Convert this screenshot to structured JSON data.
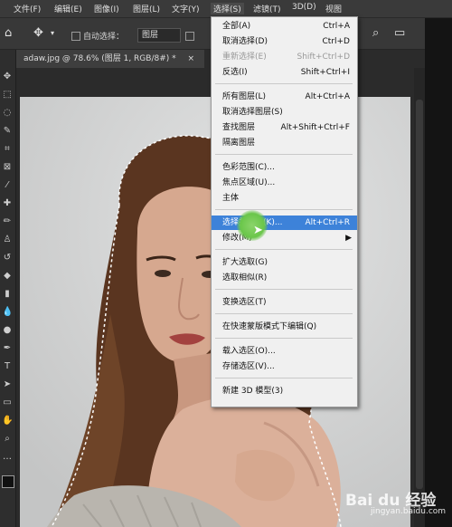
{
  "menubar": {
    "items": [
      {
        "label": "文件(F)"
      },
      {
        "label": "编辑(E)"
      },
      {
        "label": "图像(I)"
      },
      {
        "label": "图层(L)"
      },
      {
        "label": "文字(Y)"
      },
      {
        "label": "选择(S)"
      },
      {
        "label": "滤镜(T)"
      },
      {
        "label": "3D(D)"
      },
      {
        "label": "视图"
      }
    ]
  },
  "options_bar": {
    "auto_select_label": "自动选择：",
    "auto_select_target": "图层"
  },
  "document_tab": {
    "title": "adaw.jpg @ 78.6% (图层 1, RGB/8#) *",
    "close": "×"
  },
  "select_menu": {
    "items": [
      {
        "label": "全部(A)",
        "shortcut": "Ctrl+A"
      },
      {
        "label": "取消选择(D)",
        "shortcut": "Ctrl+D"
      },
      {
        "label": "重新选择(E)",
        "shortcut": "Shift+Ctrl+D",
        "disabled": true
      },
      {
        "label": "反选(I)",
        "shortcut": "Shift+Ctrl+I"
      },
      {
        "label": "所有图层(L)",
        "shortcut": "Alt+Ctrl+A"
      },
      {
        "label": "取消选择图层(S)",
        "shortcut": ""
      },
      {
        "label": "查找图层",
        "shortcut": "Alt+Shift+Ctrl+F"
      },
      {
        "label": "隔离图层",
        "shortcut": ""
      },
      {
        "label": "色彩范围(C)...",
        "shortcut": ""
      },
      {
        "label": "焦点区域(U)...",
        "shortcut": ""
      },
      {
        "label": "主体",
        "shortcut": ""
      },
      {
        "label": "选择并遮住(K)...",
        "shortcut": "Alt+Ctrl+R",
        "highlighted": true
      },
      {
        "label": "修改(M)",
        "shortcut": "",
        "submenu": "▶"
      },
      {
        "label": "扩大选取(G)",
        "shortcut": ""
      },
      {
        "label": "选取相似(R)",
        "shortcut": ""
      },
      {
        "label": "变换选区(T)",
        "shortcut": ""
      },
      {
        "label": "在快速蒙版模式下编辑(Q)",
        "shortcut": ""
      },
      {
        "label": "载入选区(O)...",
        "shortcut": ""
      },
      {
        "label": "存储选区(V)...",
        "shortcut": ""
      },
      {
        "label": "新建 3D 模型(3)",
        "shortcut": ""
      }
    ]
  },
  "watermark": {
    "brand": "Bai du 经验",
    "url": "jingyan.baidu.com"
  },
  "colors": {
    "menu_bg": "#f0f0f0",
    "highlight": "#3d82d9",
    "app_bg": "#383838"
  }
}
